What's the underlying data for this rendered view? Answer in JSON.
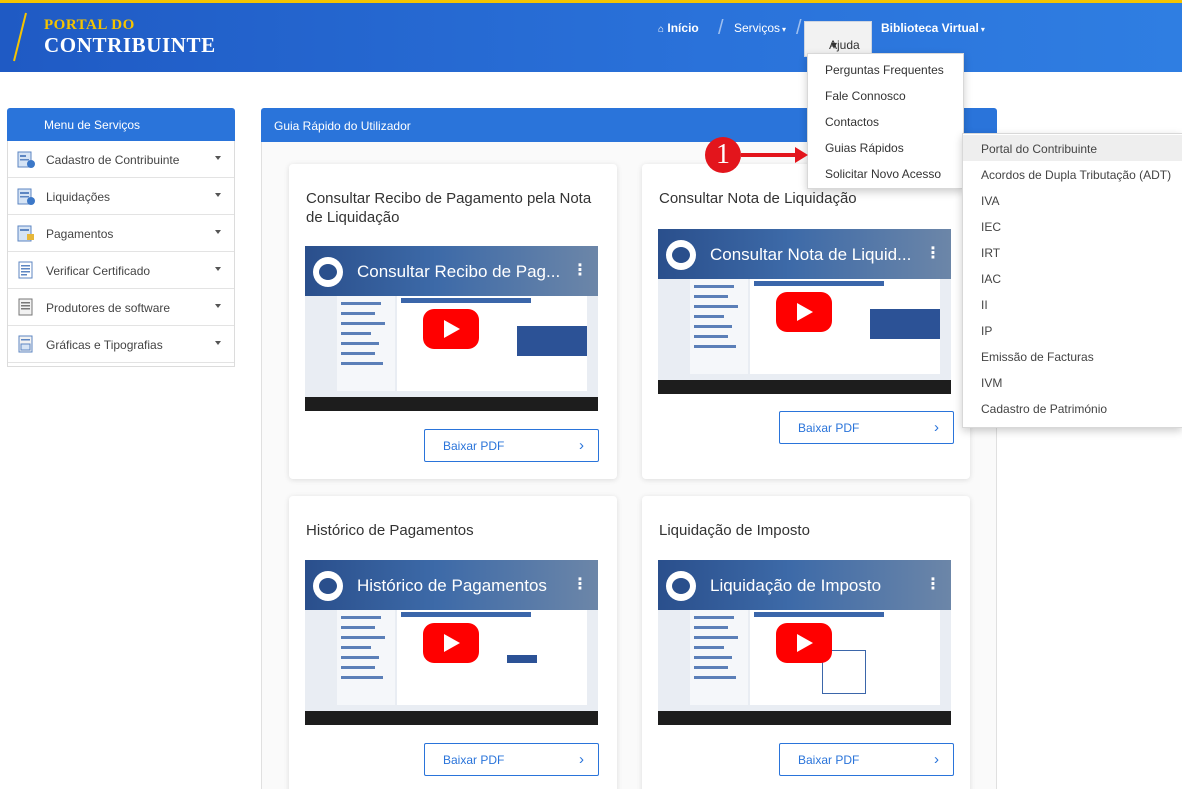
{
  "brand": {
    "line1": "PORTAL DO",
    "line2": "CONTRIBUINTE"
  },
  "nav": {
    "inicio": "Início",
    "servicos": "Serviços",
    "ajuda": "Ajuda",
    "biblioteca": "Biblioteca Virtual",
    "caret": "▾"
  },
  "ajuda_menu": [
    "Perguntas Frequentes",
    "Fale Connosco",
    "Contactos",
    "Guias Rápidos",
    "Solicitar Novo Acesso"
  ],
  "guias_menu": [
    "Portal do Contribuinte",
    "Acordos de Dupla Tributação (ADT)",
    "IVA",
    "IEC",
    "IRT",
    "IAC",
    "II",
    "IP",
    "Emissão de Facturas",
    "IVM",
    "Cadastro de Património"
  ],
  "annotation": {
    "number": "1",
    "color": "#e3151c"
  },
  "sidebar": {
    "title": "Menu de Serviços",
    "items": [
      {
        "label": "Cadastro de Contribuinte",
        "icon": "id-card-icon"
      },
      {
        "label": "Liquidações",
        "icon": "calculator-doc-icon"
      },
      {
        "label": "Pagamentos",
        "icon": "payment-doc-icon"
      },
      {
        "label": "Verificar Certificado",
        "icon": "certificate-icon"
      },
      {
        "label": "Produtores de software",
        "icon": "software-doc-icon"
      },
      {
        "label": "Gráficas e Tipografias",
        "icon": "print-doc-icon"
      }
    ]
  },
  "panel": {
    "title": "Guia Rápido do Utilizador"
  },
  "cards": [
    {
      "title": "Consultar Recibo de Pagamento pela Nota de Liquidação",
      "video_title": "Consultar Recibo de Pag...",
      "button": "Baixar PDF"
    },
    {
      "title": "Consultar Nota de Liquidação",
      "video_title": "Consultar Nota de Liquid...",
      "button": "Baixar PDF"
    },
    {
      "title": "Histórico de Pagamentos",
      "video_title": "Histórico de Pagamentos",
      "button": "Baixar PDF"
    },
    {
      "title": "Liquidação de Imposto",
      "video_title": "Liquidação de Imposto",
      "button": "Baixar PDF"
    }
  ],
  "colors": {
    "header": "#2a72da",
    "accent": "#2a74da",
    "brand_yellow": "#f5c400",
    "youtube_red": "#ff0000"
  }
}
